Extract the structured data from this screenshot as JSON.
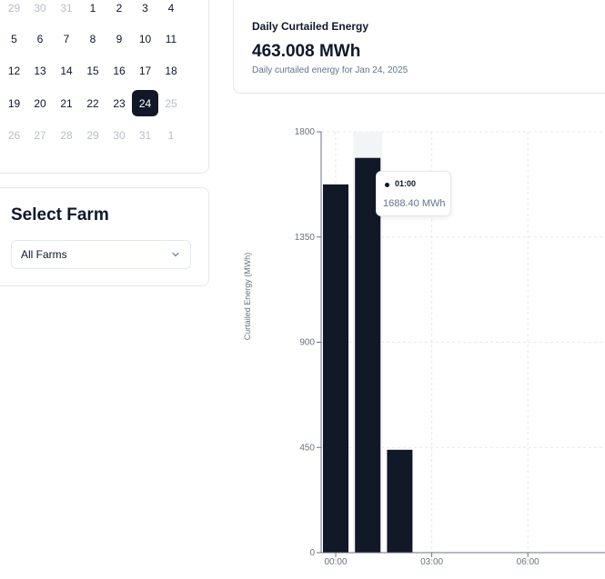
{
  "calendar": {
    "weeks": [
      [
        {
          "d": "29",
          "muted": true
        },
        {
          "d": "30",
          "muted": true
        },
        {
          "d": "31",
          "muted": true
        },
        {
          "d": "1"
        },
        {
          "d": "2"
        },
        {
          "d": "3"
        },
        {
          "d": "4"
        }
      ],
      [
        {
          "d": "5"
        },
        {
          "d": "6"
        },
        {
          "d": "7"
        },
        {
          "d": "8"
        },
        {
          "d": "9"
        },
        {
          "d": "10"
        },
        {
          "d": "11"
        }
      ],
      [
        {
          "d": "12"
        },
        {
          "d": "13"
        },
        {
          "d": "14"
        },
        {
          "d": "15"
        },
        {
          "d": "16"
        },
        {
          "d": "17"
        },
        {
          "d": "18"
        }
      ],
      [
        {
          "d": "19"
        },
        {
          "d": "20"
        },
        {
          "d": "21"
        },
        {
          "d": "22"
        },
        {
          "d": "23"
        },
        {
          "d": "24",
          "selected": true
        },
        {
          "d": "25",
          "muted": true
        }
      ],
      [
        {
          "d": "26",
          "muted": true
        },
        {
          "d": "27",
          "muted": true
        },
        {
          "d": "28",
          "muted": true
        },
        {
          "d": "29",
          "muted": true
        },
        {
          "d": "30",
          "muted": true
        },
        {
          "d": "31",
          "muted": true
        },
        {
          "d": "1",
          "muted": true
        }
      ]
    ]
  },
  "farm": {
    "title": "Select Farm",
    "selected": "All Farms"
  },
  "energy": {
    "label": "Daily Curtailed Energy",
    "value": "463.008 MWh",
    "subtitle": "Daily curtailed energy for Jan 24, 2025"
  },
  "tooltip": {
    "time": "01:00",
    "value": "1688.40 MWh"
  },
  "colors": {
    "bar": "#111827",
    "hover": "#f3f4f6",
    "selected_day": "#111827"
  },
  "chart_data": {
    "type": "bar",
    "ylabel": "Curtailed Energy (MWh)",
    "xlabel": "",
    "ylim": [
      0,
      1800
    ],
    "yticks": [
      0,
      450,
      900,
      1350,
      1800
    ],
    "xticks": [
      {
        "x": 0,
        "label": "00:00"
      },
      {
        "x": 3,
        "label": "03:00"
      },
      {
        "x": 6,
        "label": "06:00"
      }
    ],
    "categories": [
      "00:00",
      "01:00",
      "02:00"
    ],
    "values": [
      1575,
      1688.4,
      440
    ],
    "highlighted": "01:00",
    "grid": true
  }
}
